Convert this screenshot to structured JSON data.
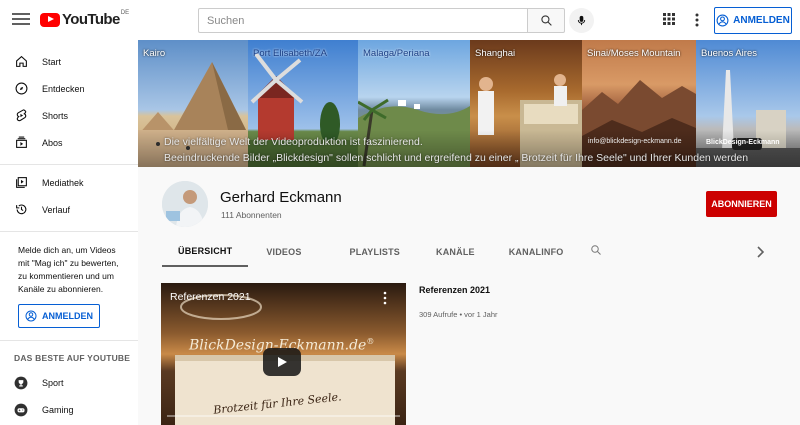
{
  "header": {
    "logo_text": "YouTube",
    "country_code": "DE",
    "search_placeholder": "Suchen",
    "signin_label": "ANMELDEN"
  },
  "sidebar": {
    "items": [
      {
        "label": "Start",
        "icon": "home-icon"
      },
      {
        "label": "Entdecken",
        "icon": "compass-icon"
      },
      {
        "label": "Shorts",
        "icon": "shorts-icon"
      },
      {
        "label": "Abos",
        "icon": "subscriptions-icon"
      }
    ],
    "library_items": [
      {
        "label": "Mediathek",
        "icon": "library-icon"
      },
      {
        "label": "Verlauf",
        "icon": "history-icon"
      }
    ],
    "signin_message": "Melde dich an, um Videos mit \"Mag ich\" zu bewerten, zu kommentieren und um Kanäle zu abonnieren.",
    "signin_label": "ANMELDEN",
    "best_heading": "DAS BESTE AUF YOUTUBE",
    "best_items": [
      {
        "label": "Sport",
        "icon": "trophy-icon"
      },
      {
        "label": "Gaming",
        "icon": "gaming-icon"
      }
    ]
  },
  "banner": {
    "locations": [
      "Kairo",
      "Port Elisabeth/ZA",
      "Malaga/Periana",
      "Shanghai",
      "Sinai/Moses Mountain",
      "Buenos Aires"
    ],
    "line1": "Die vielfältige Welt  der Videoproduktion ist faszinierend.",
    "line2": "Beeindruckende Bilder  „Blickdesign\" sollen schlicht und ergreifend zu einer „ Brotzeit für Ihre Seele\" und Ihrer Kunden werden",
    "email": "info@blickdesign-eckmann.de",
    "brand": "BlickDesign-Eckmann"
  },
  "channel": {
    "name": "Gerhard Eckmann",
    "subscribers": "111 Abonnenten",
    "subscribe_label": "ABONNIEREN",
    "tabs": [
      "ÜBERSICHT",
      "VIDEOS",
      "PLAYLISTS",
      "KANÄLE",
      "KANALINFO"
    ]
  },
  "video": {
    "thumb_title": "Referenzen 2021",
    "thumb_brand": "BlickDesign-Eckmann.de",
    "thumb_reg": "®",
    "thumb_slogan": "Brotzeit für Ihre Seele.",
    "title": "Referenzen 2021",
    "meta": "309 Aufrufe • vor 1 Jahr"
  },
  "colors": {
    "brand_red": "#ff0000",
    "subscribe_red": "#cc0000",
    "link_blue": "#065fd4"
  }
}
